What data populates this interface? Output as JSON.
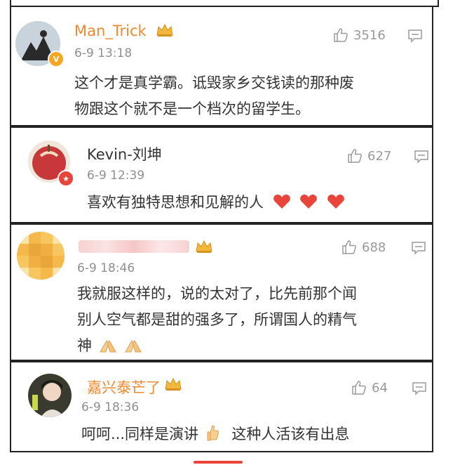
{
  "comments": [
    {
      "name": "Man_Trick",
      "time": "6-9 13:18",
      "likes": "3516",
      "text_line1": "这个才是真学霸。诋毁家乡交钱读的那种废",
      "text_line2": "物跟这个就不是一个档次的留学生。"
    },
    {
      "name": "Kevin-刘坤",
      "time": "6-9 12:39",
      "likes": "627",
      "text_line1": "喜欢有独特思想和见解的人"
    },
    {
      "name": "",
      "time": "6-9 18:46",
      "likes": "688",
      "text_line1": "我就服这样的，说的太对了，比先前那个闻",
      "text_line2": "别人空气都是甜的强多了，所谓国人的精气",
      "text_line3": "神"
    },
    {
      "name": "嘉兴泰芒了",
      "time": "6-9 18:36",
      "likes": "64",
      "text_line1": "呵呵...同样是演讲",
      "text_line2": "这种人活该有出息"
    }
  ],
  "colors": {
    "name_orange": "#ec8a30",
    "heart_red": "#e8443a",
    "text": "#333333",
    "meta": "#8f8f8f"
  }
}
